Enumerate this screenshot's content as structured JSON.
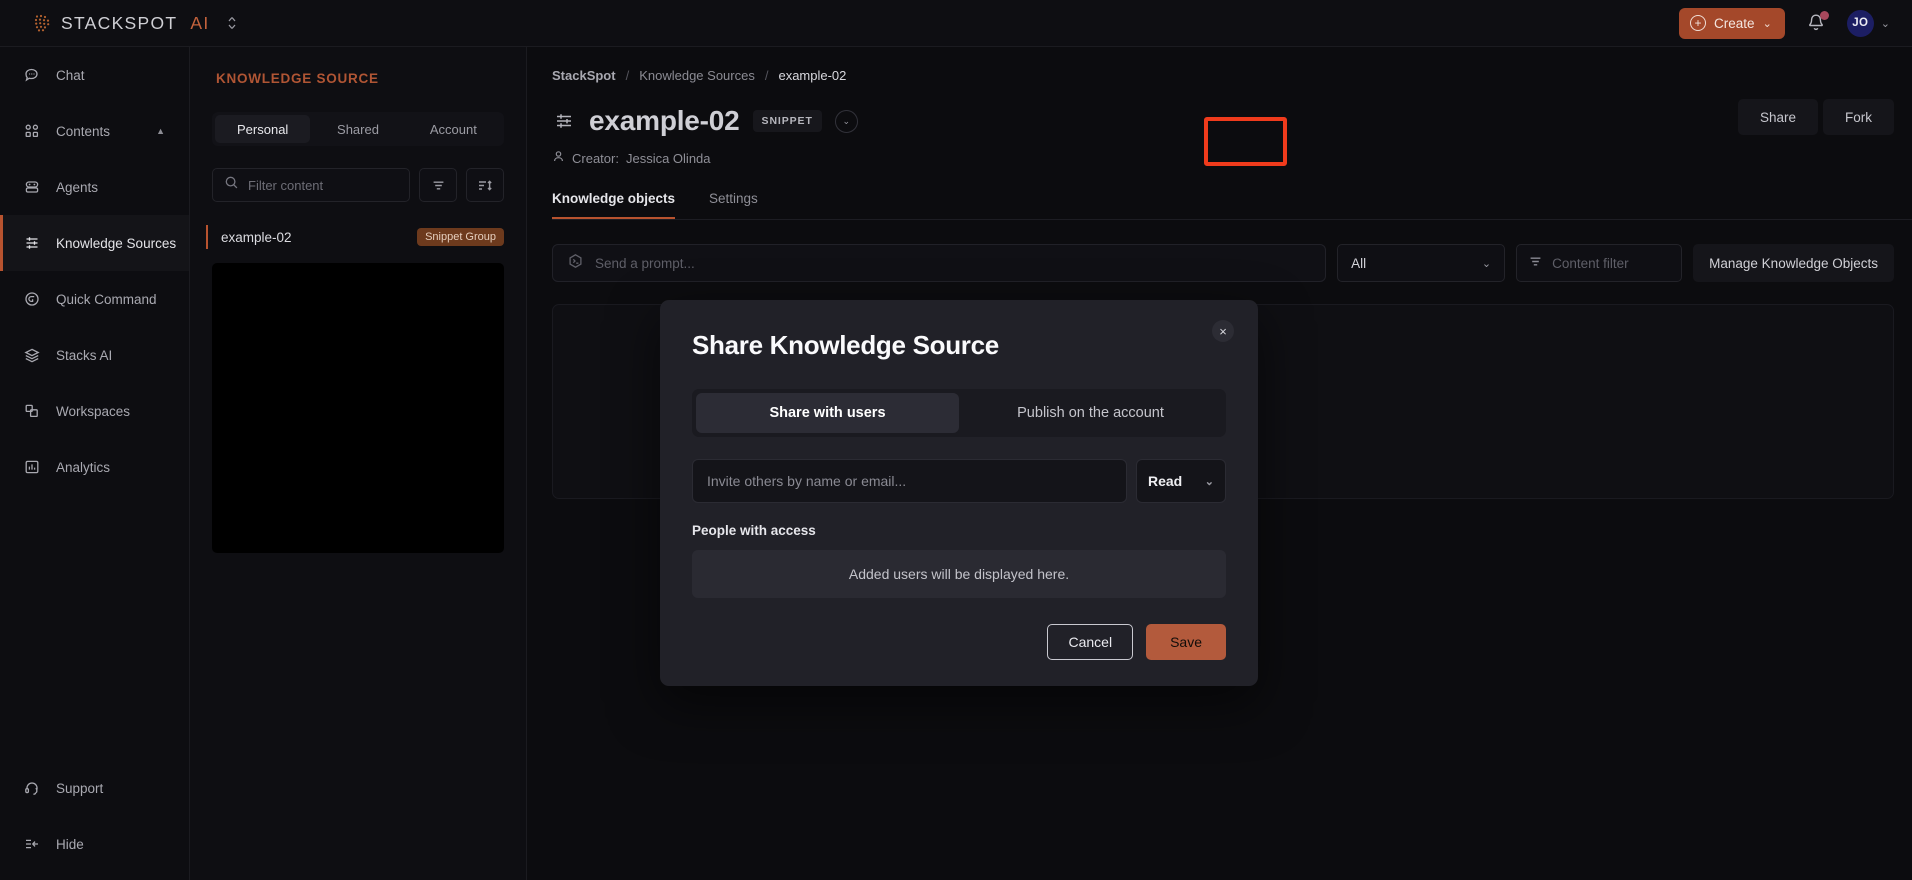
{
  "topbar": {
    "brand_name": "STACKSPOT",
    "brand_suffix": "AI",
    "brand_switch_icon": "updown-chevron-icon",
    "create_label": "Create",
    "create_icon": "plus-circle-icon",
    "create_caret": "⌄",
    "notification_icon": "bell-icon",
    "avatar_initials": "JO",
    "avatar_caret": "⌄"
  },
  "sidebar": {
    "items": [
      {
        "label": "Chat",
        "icon": "chat-bubble-icon",
        "active": false
      },
      {
        "label": "Contents",
        "icon": "grid-squares-icon",
        "active": false,
        "caret": "▲"
      },
      {
        "label": "Agents",
        "icon": "robot-icon",
        "active": false
      },
      {
        "label": "Knowledge Sources",
        "icon": "stacked-lines-icon",
        "active": true
      },
      {
        "label": "Quick Command",
        "icon": "command-hexagon-icon",
        "active": false
      },
      {
        "label": "Stacks AI",
        "icon": "layers-icon",
        "active": false
      },
      {
        "label": "Workspaces",
        "icon": "workspace-squares-icon",
        "active": false
      },
      {
        "label": "Analytics",
        "icon": "bar-chart-icon",
        "active": false
      }
    ],
    "bottom_items": [
      {
        "label": "Support",
        "icon": "headset-icon"
      },
      {
        "label": "Hide",
        "icon": "collapse-left-icon"
      }
    ]
  },
  "ks_panel": {
    "title": "KNOWLEDGE SOURCE",
    "tabs": [
      {
        "label": "Personal",
        "active": true
      },
      {
        "label": "Shared",
        "active": false
      },
      {
        "label": "Account",
        "active": false
      }
    ],
    "filter_placeholder": "Filter content",
    "filter_value": "",
    "search_icon": "search-icon",
    "filter_icon": "filter-icon",
    "sort_icon": "sort-icon",
    "item": {
      "label": "example-02",
      "badge": "Snippet Group"
    }
  },
  "main": {
    "breadcrumb": [
      {
        "label": "StackSpot"
      },
      {
        "label": "Knowledge Sources"
      },
      {
        "label": "example-02"
      }
    ],
    "breadcrumb_separator": "/",
    "title": "example-02",
    "title_icon": "stacked-lines-icon",
    "type_badge": "SNIPPET",
    "title_caret": "⌄",
    "creator_label": "Creator:",
    "creator_name": "Jessica Olinda",
    "creator_icon": "person-icon",
    "actions": [
      {
        "label": "Share",
        "highlighted": true
      },
      {
        "label": "Fork",
        "highlighted": false
      }
    ],
    "tabs": [
      {
        "label": "Knowledge objects",
        "active": true
      },
      {
        "label": "Settings",
        "active": false
      }
    ],
    "prompt_placeholder": "Send a prompt...",
    "prompt_icon": "terminal-hexagon-icon",
    "scope_select_value": "All",
    "scope_select_caret": "⌄",
    "content_filter_placeholder": "Content filter",
    "content_filter_icon": "filter-icon",
    "manage_button": "Manage Knowledge Objects"
  },
  "modal": {
    "title": "Share Knowledge Source",
    "close_icon": "close-icon",
    "close_glyph": "×",
    "tabs": [
      {
        "label": "Share with users",
        "active": true
      },
      {
        "label": "Publish on the account",
        "active": false
      }
    ],
    "invite_placeholder": "Invite others by name or email...",
    "invite_value": "",
    "permission_value": "Read",
    "permission_caret": "⌄",
    "people_label": "People with access",
    "people_empty": "Added users will be displayed here.",
    "cancel_label": "Cancel",
    "save_label": "Save"
  },
  "colors": {
    "accent": "#b8532f",
    "accent_button": "#b35a3c",
    "create_button": "#a4482a",
    "highlight_box": "#f03b1c",
    "avatar_bg": "#1c1e63",
    "badge_bg": "#6d3a1d"
  }
}
